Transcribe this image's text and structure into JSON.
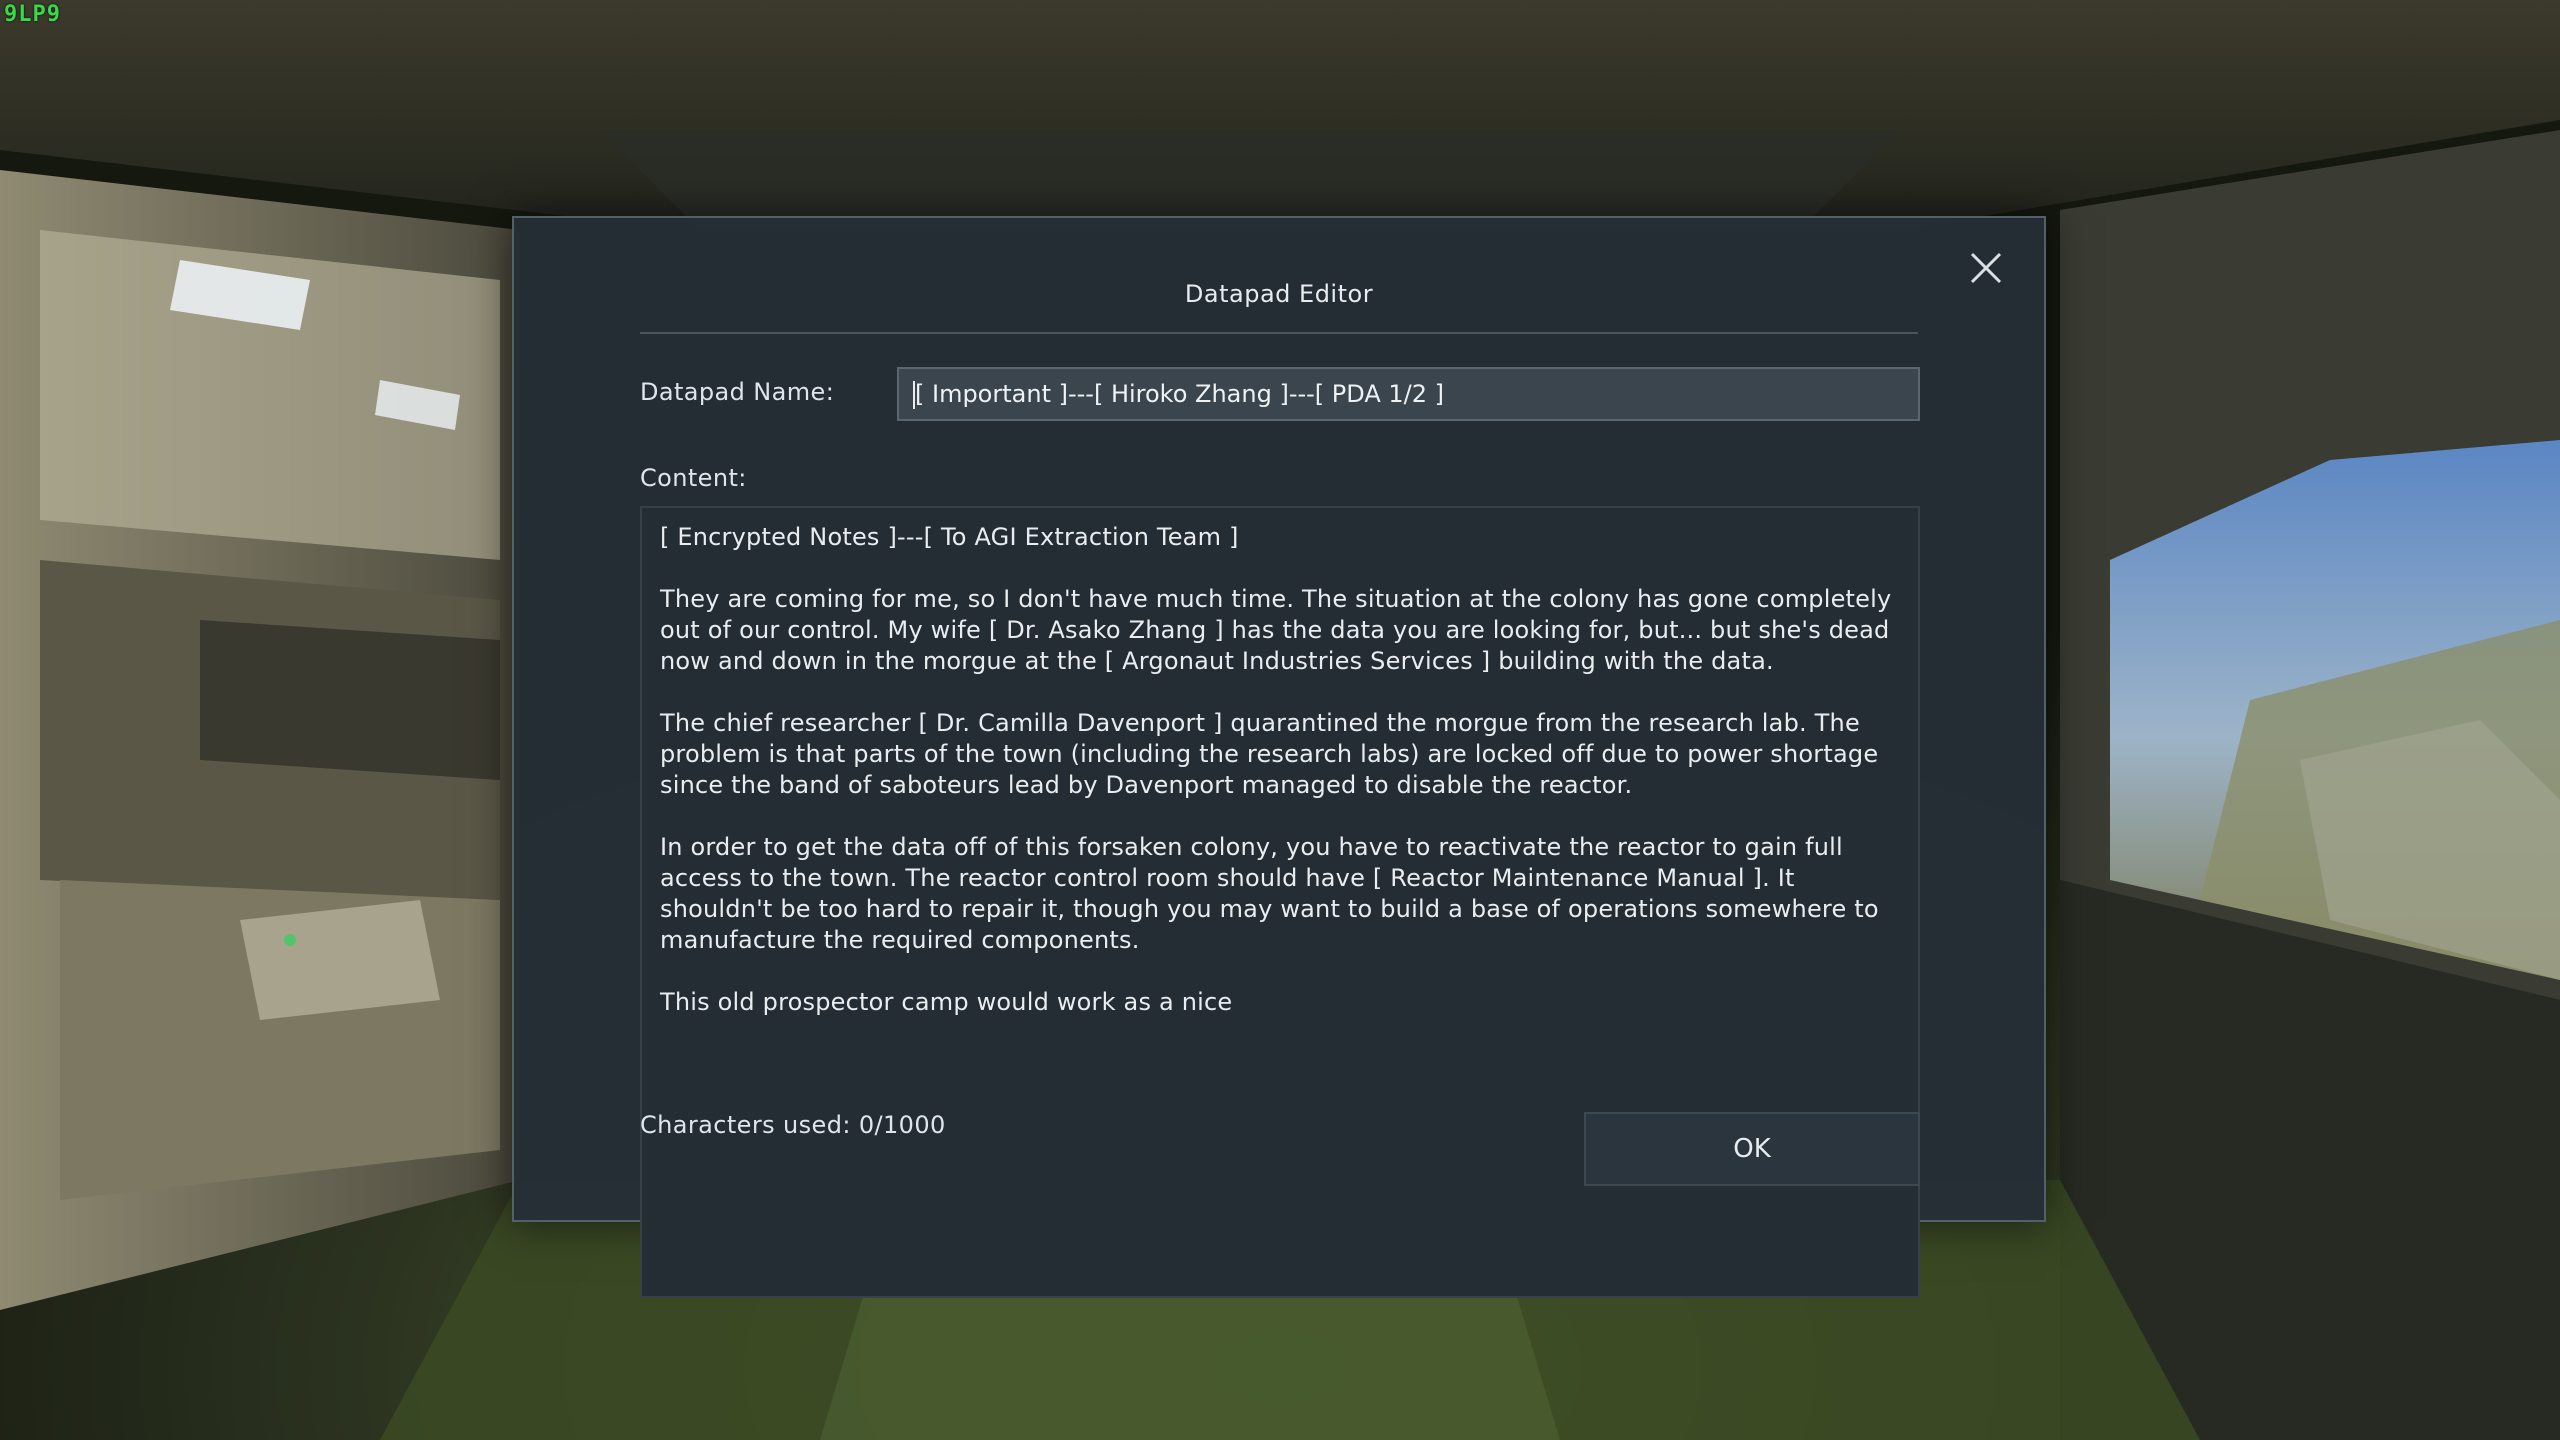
{
  "hud": {
    "fps_text": "9LP9"
  },
  "dialog": {
    "title": "Datapad Editor",
    "name_label": "Datapad Name:",
    "name_value": "[ Important ]---[ Hiroko Zhang ]---[ PDA 1/2 ]",
    "content_label": "Content:",
    "content_paragraphs": [
      "[ Encrypted Notes ]---[ To AGI Extraction Team ]",
      "They are coming for me, so I don't have much time. The situation at the colony has gone completely out of our control. My wife [ Dr. Asako Zhang ] has the data you are looking for, but... but she's dead now and down in the morgue at the [ Argonaut Industries Services ] building with the data.",
      "The chief researcher [ Dr. Camilla Davenport ] quarantined the morgue from the research lab. The problem is that parts of the town (including the research labs) are locked off due to power shortage since the band of saboteurs lead by Davenport managed to disable the reactor.",
      "In order to get the data off of this forsaken colony, you have to reactivate the reactor to gain full access to the town. The reactor control room should have [ Reactor Maintenance Manual ]. It shouldn't be too hard to repair it, though you may want to build a base of operations somewhere to manufacture the required components.",
      "This old prospector camp would work as a nice"
    ],
    "char_count": "Characters used: 0/1000",
    "ok_label": "OK"
  },
  "colors": {
    "dialog_bg": "#252e36",
    "field_bg": "#3a454d",
    "text": "#e9edef",
    "fps": "#39d94a"
  }
}
